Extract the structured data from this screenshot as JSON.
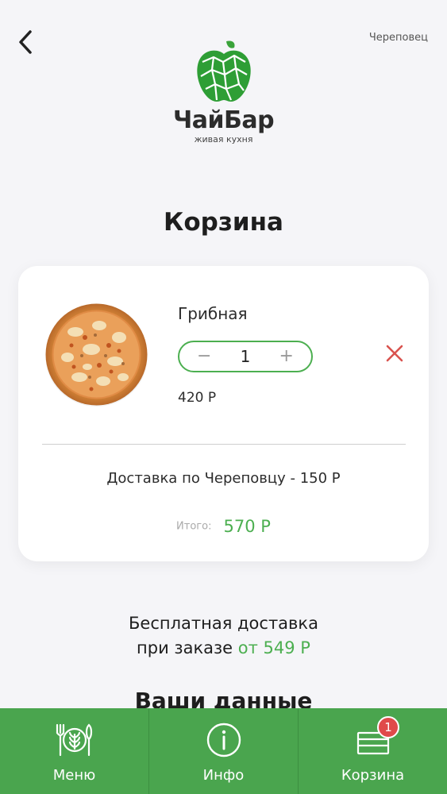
{
  "header": {
    "city": "Череповец",
    "brand_name": "ЧайБар",
    "brand_subtitle": "живая кухня"
  },
  "page_title": "Корзина",
  "cart": {
    "items": [
      {
        "name": "Грибная",
        "quantity": "1",
        "price": "420 Р",
        "image_icon": "pizza-image"
      }
    ],
    "delivery_text": "Доставка по Череповцу - 150 Р",
    "total_label": "Итого:",
    "total_value": "570 Р"
  },
  "promo": {
    "line1": "Бесплатная доставка",
    "line2_prefix": "при заказе",
    "line2_accent": "от 549 Р"
  },
  "next_section_title": "Ваши данные",
  "bottom_nav": {
    "items": [
      {
        "label": "Меню",
        "icon": "menu-cutlery-icon"
      },
      {
        "label": "Инфо",
        "icon": "info-icon"
      },
      {
        "label": "Корзина",
        "icon": "cart-icon",
        "badge": "1"
      }
    ]
  },
  "colors": {
    "accent": "#4caf50",
    "nav_background": "#4aa54e",
    "remove": "#d9534f",
    "badge": "#e04a4a"
  }
}
